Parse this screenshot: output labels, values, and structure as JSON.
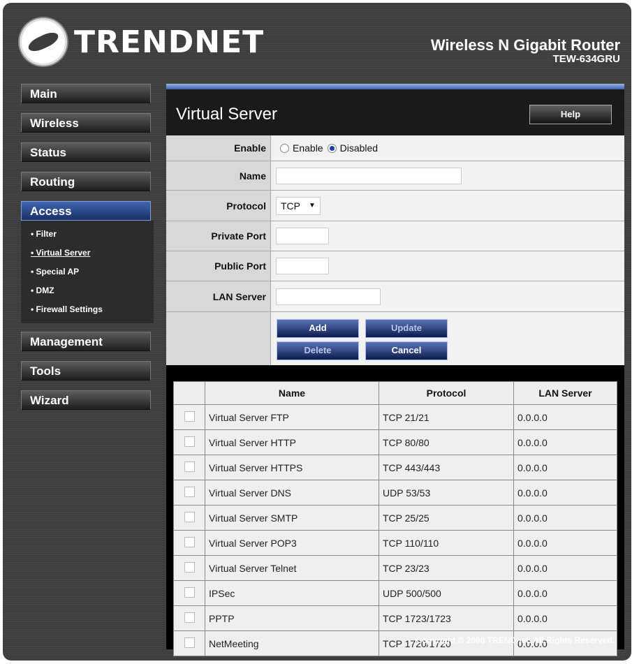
{
  "brand": {
    "logo_text": "TRENDNET",
    "product_name": "Wireless N Gigabit Router",
    "model": "TEW-634GRU"
  },
  "sidebar": {
    "items": [
      {
        "label": "Main"
      },
      {
        "label": "Wireless"
      },
      {
        "label": "Status"
      },
      {
        "label": "Routing"
      },
      {
        "label": "Access"
      },
      {
        "label": "Management"
      },
      {
        "label": "Tools"
      },
      {
        "label": "Wizard"
      }
    ],
    "access_sub": [
      {
        "label": "• Filter"
      },
      {
        "label": "• Virtual Server"
      },
      {
        "label": "• Special AP"
      },
      {
        "label": "• DMZ"
      },
      {
        "label": "• Firewall Settings"
      }
    ]
  },
  "page": {
    "title": "Virtual Server",
    "help_label": "Help"
  },
  "form": {
    "enable_label": "Enable",
    "enable_option": "Enable",
    "disabled_option": "Disabled",
    "selected": "Disabled",
    "name_label": "Name",
    "name_value": "",
    "protocol_label": "Protocol",
    "protocol_value": "TCP",
    "private_port_label": "Private Port",
    "private_port_value": "",
    "public_port_label": "Public Port",
    "public_port_value": "",
    "lan_server_label": "LAN Server",
    "lan_server_value": "",
    "buttons": {
      "add": "Add",
      "update": "Update",
      "delete": "Delete",
      "cancel": "Cancel"
    }
  },
  "table": {
    "headers": [
      "",
      "Name",
      "Protocol",
      "LAN Server"
    ],
    "rows": [
      {
        "name": "Virtual Server FTP",
        "protocol": "TCP 21/21",
        "lan": "0.0.0.0"
      },
      {
        "name": "Virtual Server HTTP",
        "protocol": "TCP 80/80",
        "lan": "0.0.0.0"
      },
      {
        "name": "Virtual Server HTTPS",
        "protocol": "TCP 443/443",
        "lan": "0.0.0.0"
      },
      {
        "name": "Virtual Server DNS",
        "protocol": "UDP 53/53",
        "lan": "0.0.0.0"
      },
      {
        "name": "Virtual Server SMTP",
        "protocol": "TCP 25/25",
        "lan": "0.0.0.0"
      },
      {
        "name": "Virtual Server POP3",
        "protocol": "TCP 110/110",
        "lan": "0.0.0.0"
      },
      {
        "name": "Virtual Server Telnet",
        "protocol": "TCP 23/23",
        "lan": "0.0.0.0"
      },
      {
        "name": "IPSec",
        "protocol": "UDP 500/500",
        "lan": "0.0.0.0"
      },
      {
        "name": "PPTP",
        "protocol": "TCP 1723/1723",
        "lan": "0.0.0.0"
      },
      {
        "name": "NetMeeting",
        "protocol": "TCP 1720/1720",
        "lan": "0.0.0.0"
      }
    ]
  },
  "footer": {
    "copyright": "Copyright © 2008 TRENDnet. All Rights Reserved."
  },
  "colors": {
    "accent": "#2b4a94",
    "panel": "#d8d8d8"
  }
}
